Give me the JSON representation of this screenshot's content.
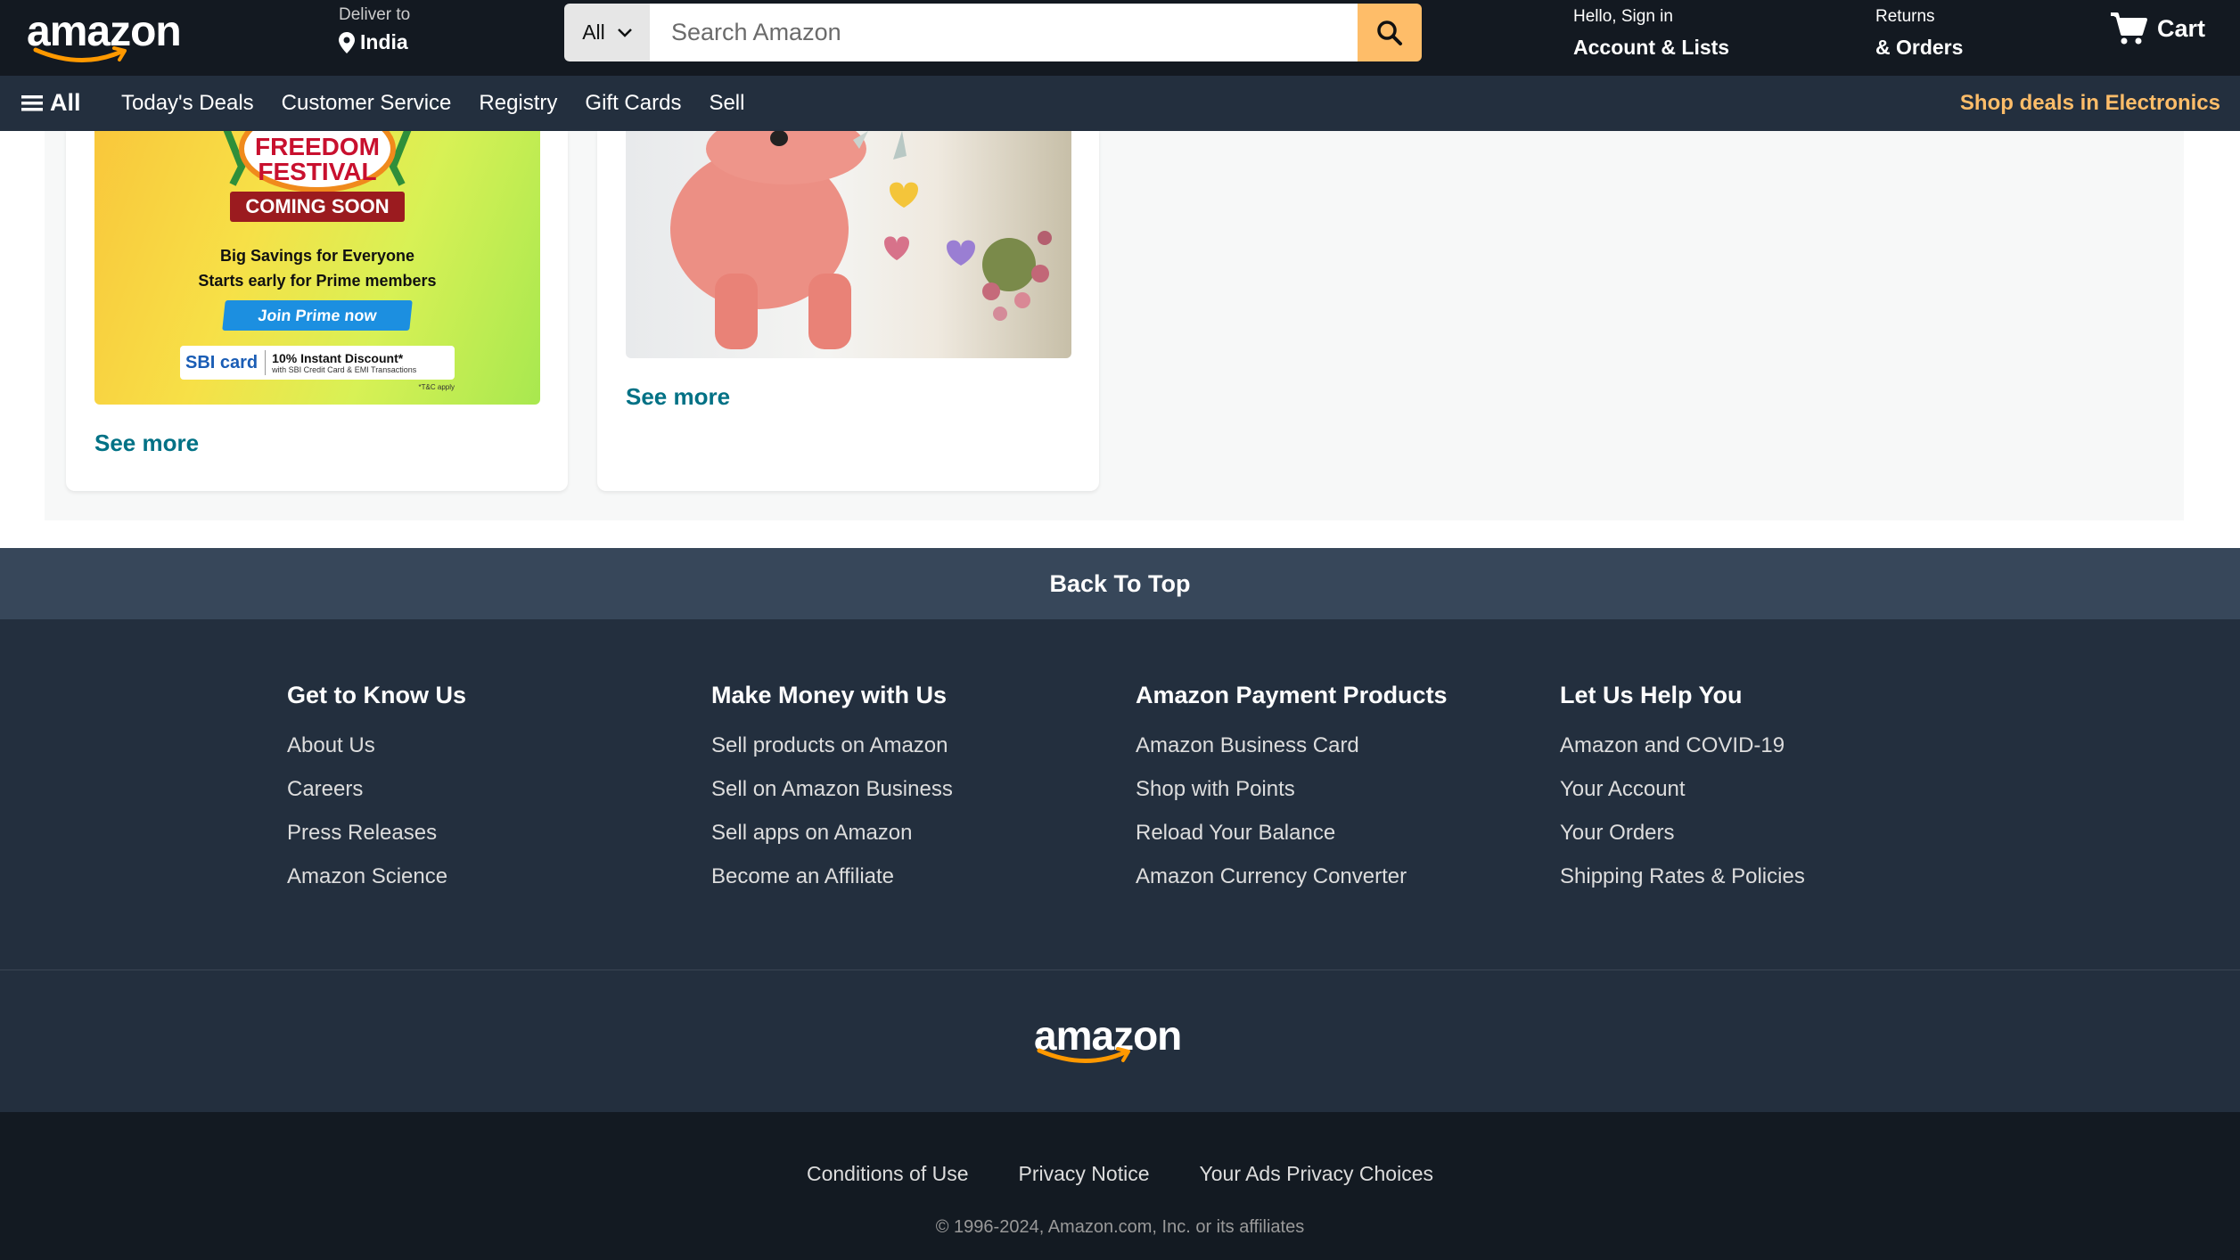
{
  "header": {
    "logo_text": "amazon",
    "deliver_label": "Deliver to",
    "deliver_location": "India",
    "search": {
      "category": "All",
      "placeholder": "Search Amazon"
    },
    "account_greeting": "Hello, Sign in",
    "account_label": "Account & Lists",
    "returns_label": "Returns",
    "orders_label": "& Orders",
    "cart_label": "Cart"
  },
  "nav": {
    "all_label": "All",
    "links": [
      "Today's Deals",
      "Customer Service",
      "Registry",
      "Gift Cards",
      "Sell"
    ],
    "promo_link": "Shop deals in Electronics"
  },
  "cards": [
    {
      "promo": {
        "title_line1": "FREEDOM",
        "title_line2": "FESTIVAL",
        "badge": "COMING SOON",
        "line1": "Big Savings for Everyone",
        "line2": "Starts early for Prime members",
        "button": "Join Prime now",
        "bank_logo": "SBI card",
        "discount": "10% Instant Discount*",
        "discount_note": "with SBI Credit Card & EMI Transactions",
        "tc": "*T&C apply"
      },
      "see_more": "See more"
    },
    {
      "see_more": "See more"
    }
  ],
  "back_to_top": "Back To Top",
  "footer": {
    "columns": [
      {
        "title": "Get to Know Us",
        "links": [
          "About Us",
          "Careers",
          "Press Releases",
          "Amazon Science"
        ]
      },
      {
        "title": "Make Money with Us",
        "links": [
          "Sell products on Amazon",
          "Sell on Amazon Business",
          "Sell apps on Amazon",
          "Become an Affiliate"
        ]
      },
      {
        "title": "Amazon Payment Products",
        "links": [
          "Amazon Business Card",
          "Shop with Points",
          "Reload Your Balance",
          "Amazon Currency Converter"
        ]
      },
      {
        "title": "Let Us Help You",
        "links": [
          "Amazon and COVID-19",
          "Your Account",
          "Your Orders",
          "Shipping Rates & Policies"
        ]
      }
    ],
    "logo_text": "amazon"
  },
  "legal": {
    "links": [
      "Conditions of Use",
      "Privacy Notice",
      "Your Ads Privacy Choices"
    ],
    "copyright": "© 1996-2024, Amazon.com, Inc. or its affiliates"
  },
  "colors": {
    "header_bg": "#131921",
    "nav_bg": "#232f3e",
    "accent": "#febd69",
    "link": "#007185",
    "back_to_top_bg": "#37475a",
    "legal_bg": "#131a22"
  },
  "icons": {
    "location": "map-pin-icon",
    "search": "search-icon",
    "cart": "cart-icon",
    "menu": "hamburger-menu-icon",
    "dropdown": "chevron-down-icon"
  }
}
